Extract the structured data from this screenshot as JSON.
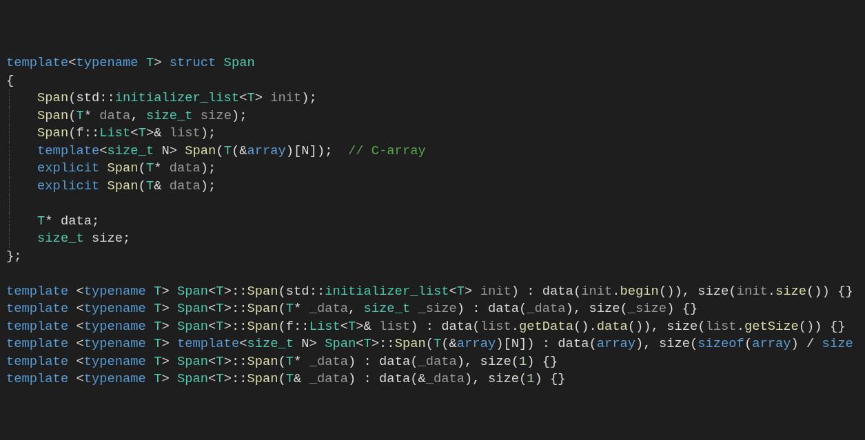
{
  "editor": {
    "blocks": [
      {
        "lines": [
          {
            "tokens": [
              {
                "kind": "keyword",
                "text": "template"
              },
              {
                "kind": "plain",
                "text": "<"
              },
              {
                "kind": "keyword",
                "text": "typename"
              },
              {
                "kind": "type",
                "text": " T"
              },
              {
                "kind": "plain",
                "text": "> "
              },
              {
                "kind": "keyword",
                "text": "struct"
              },
              {
                "kind": "type",
                "text": " Span"
              }
            ]
          },
          {
            "tokens": [
              {
                "kind": "plain",
                "text": "{"
              }
            ]
          },
          {
            "guide": true,
            "tokens": [
              {
                "kind": "function",
                "text": "    Span"
              },
              {
                "kind": "plain",
                "text": "(std::"
              },
              {
                "kind": "type",
                "text": "initializer_list"
              },
              {
                "kind": "plain",
                "text": "<"
              },
              {
                "kind": "type",
                "text": "T"
              },
              {
                "kind": "plain",
                "text": "> "
              },
              {
                "kind": "param",
                "text": "init"
              },
              {
                "kind": "plain",
                "text": ");"
              }
            ]
          },
          {
            "guide": true,
            "tokens": [
              {
                "kind": "function",
                "text": "    Span"
              },
              {
                "kind": "plain",
                "text": "("
              },
              {
                "kind": "type",
                "text": "T"
              },
              {
                "kind": "plain",
                "text": "* "
              },
              {
                "kind": "param",
                "text": "data"
              },
              {
                "kind": "plain",
                "text": ", "
              },
              {
                "kind": "type",
                "text": "size_t"
              },
              {
                "kind": "param",
                "text": " size"
              },
              {
                "kind": "plain",
                "text": ");"
              }
            ]
          },
          {
            "guide": true,
            "tokens": [
              {
                "kind": "function",
                "text": "    Span"
              },
              {
                "kind": "plain",
                "text": "(f::"
              },
              {
                "kind": "type",
                "text": "List"
              },
              {
                "kind": "plain",
                "text": "<"
              },
              {
                "kind": "type",
                "text": "T"
              },
              {
                "kind": "plain",
                "text": ">& "
              },
              {
                "kind": "param",
                "text": "list"
              },
              {
                "kind": "plain",
                "text": ");"
              }
            ]
          },
          {
            "guide": true,
            "tokens": [
              {
                "kind": "keyword",
                "text": "    template"
              },
              {
                "kind": "plain",
                "text": "<"
              },
              {
                "kind": "type",
                "text": "size_t"
              },
              {
                "kind": "plain",
                "text": " N> "
              },
              {
                "kind": "function",
                "text": "Span"
              },
              {
                "kind": "plain",
                "text": "("
              },
              {
                "kind": "type",
                "text": "T"
              },
              {
                "kind": "plain",
                "text": "(&"
              },
              {
                "kind": "local",
                "text": "array"
              },
              {
                "kind": "plain",
                "text": ")[N]);  "
              },
              {
                "kind": "comment",
                "text": "// C-array"
              }
            ]
          },
          {
            "guide": true,
            "tokens": [
              {
                "kind": "keyword",
                "text": "    explicit"
              },
              {
                "kind": "function",
                "text": " Span"
              },
              {
                "kind": "plain",
                "text": "("
              },
              {
                "kind": "type",
                "text": "T"
              },
              {
                "kind": "plain",
                "text": "* "
              },
              {
                "kind": "param",
                "text": "data"
              },
              {
                "kind": "plain",
                "text": ");"
              }
            ]
          },
          {
            "guide": true,
            "tokens": [
              {
                "kind": "keyword",
                "text": "    explicit"
              },
              {
                "kind": "function",
                "text": " Span"
              },
              {
                "kind": "plain",
                "text": "("
              },
              {
                "kind": "type",
                "text": "T"
              },
              {
                "kind": "plain",
                "text": "& "
              },
              {
                "kind": "param",
                "text": "data"
              },
              {
                "kind": "plain",
                "text": ");"
              }
            ]
          },
          {
            "guide": true
          },
          {
            "guide": true,
            "tokens": [
              {
                "kind": "type",
                "text": "    T"
              },
              {
                "kind": "plain",
                "text": "* data;"
              }
            ]
          },
          {
            "guide": true,
            "tokens": [
              {
                "kind": "type",
                "text": "    size_t"
              },
              {
                "kind": "plain",
                "text": " size;"
              }
            ]
          },
          {
            "tokens": [
              {
                "kind": "plain",
                "text": "};"
              }
            ]
          }
        ]
      },
      {
        "lines": [
          {
            "tokens": [
              {
                "kind": "keyword",
                "text": "template"
              },
              {
                "kind": "plain",
                "text": " <"
              },
              {
                "kind": "keyword",
                "text": "typename"
              },
              {
                "kind": "type",
                "text": " T"
              },
              {
                "kind": "plain",
                "text": "> "
              },
              {
                "kind": "type",
                "text": "Span"
              },
              {
                "kind": "plain",
                "text": "<"
              },
              {
                "kind": "type",
                "text": "T"
              },
              {
                "kind": "plain",
                "text": ">::"
              },
              {
                "kind": "function",
                "text": "Span"
              },
              {
                "kind": "plain",
                "text": "(std::"
              },
              {
                "kind": "type",
                "text": "initializer_list"
              },
              {
                "kind": "plain",
                "text": "<"
              },
              {
                "kind": "type",
                "text": "T"
              },
              {
                "kind": "plain",
                "text": "> "
              },
              {
                "kind": "param",
                "text": "init"
              },
              {
                "kind": "plain",
                "text": ") : data("
              },
              {
                "kind": "param",
                "text": "init"
              },
              {
                "kind": "plain",
                "text": "."
              },
              {
                "kind": "function",
                "text": "begin"
              },
              {
                "kind": "plain",
                "text": "()), size("
              },
              {
                "kind": "param",
                "text": "init"
              },
              {
                "kind": "plain",
                "text": "."
              },
              {
                "kind": "function",
                "text": "size"
              },
              {
                "kind": "plain",
                "text": "()) {}"
              }
            ]
          },
          {
            "tokens": [
              {
                "kind": "keyword",
                "text": "template"
              },
              {
                "kind": "plain",
                "text": " <"
              },
              {
                "kind": "keyword",
                "text": "typename"
              },
              {
                "kind": "type",
                "text": " T"
              },
              {
                "kind": "plain",
                "text": "> "
              },
              {
                "kind": "type",
                "text": "Span"
              },
              {
                "kind": "plain",
                "text": "<"
              },
              {
                "kind": "type",
                "text": "T"
              },
              {
                "kind": "plain",
                "text": ">::"
              },
              {
                "kind": "function",
                "text": "Span"
              },
              {
                "kind": "plain",
                "text": "("
              },
              {
                "kind": "type",
                "text": "T"
              },
              {
                "kind": "plain",
                "text": "* "
              },
              {
                "kind": "param",
                "text": "_data"
              },
              {
                "kind": "plain",
                "text": ", "
              },
              {
                "kind": "type",
                "text": "size_t"
              },
              {
                "kind": "param",
                "text": " _size"
              },
              {
                "kind": "plain",
                "text": ") : data("
              },
              {
                "kind": "param",
                "text": "_data"
              },
              {
                "kind": "plain",
                "text": "), size("
              },
              {
                "kind": "param",
                "text": "_size"
              },
              {
                "kind": "plain",
                "text": ") {}"
              }
            ]
          },
          {
            "tokens": [
              {
                "kind": "keyword",
                "text": "template"
              },
              {
                "kind": "plain",
                "text": " <"
              },
              {
                "kind": "keyword",
                "text": "typename"
              },
              {
                "kind": "type",
                "text": " T"
              },
              {
                "kind": "plain",
                "text": "> "
              },
              {
                "kind": "type",
                "text": "Span"
              },
              {
                "kind": "plain",
                "text": "<"
              },
              {
                "kind": "type",
                "text": "T"
              },
              {
                "kind": "plain",
                "text": ">::"
              },
              {
                "kind": "function",
                "text": "Span"
              },
              {
                "kind": "plain",
                "text": "(f::"
              },
              {
                "kind": "type",
                "text": "List"
              },
              {
                "kind": "plain",
                "text": "<"
              },
              {
                "kind": "type",
                "text": "T"
              },
              {
                "kind": "plain",
                "text": ">& "
              },
              {
                "kind": "param",
                "text": "list"
              },
              {
                "kind": "plain",
                "text": ") : data("
              },
              {
                "kind": "param",
                "text": "list"
              },
              {
                "kind": "plain",
                "text": "."
              },
              {
                "kind": "function",
                "text": "getData"
              },
              {
                "kind": "plain",
                "text": "()."
              },
              {
                "kind": "function",
                "text": "data"
              },
              {
                "kind": "plain",
                "text": "()), size("
              },
              {
                "kind": "param",
                "text": "list"
              },
              {
                "kind": "plain",
                "text": "."
              },
              {
                "kind": "function",
                "text": "getSize"
              },
              {
                "kind": "plain",
                "text": "()) {}"
              }
            ]
          },
          {
            "tokens": [
              {
                "kind": "keyword",
                "text": "template"
              },
              {
                "kind": "plain",
                "text": " <"
              },
              {
                "kind": "keyword",
                "text": "typename"
              },
              {
                "kind": "type",
                "text": " T"
              },
              {
                "kind": "plain",
                "text": "> "
              },
              {
                "kind": "keyword",
                "text": "template"
              },
              {
                "kind": "plain",
                "text": "<"
              },
              {
                "kind": "type",
                "text": "size_t"
              },
              {
                "kind": "plain",
                "text": " N> "
              },
              {
                "kind": "type",
                "text": "Span"
              },
              {
                "kind": "plain",
                "text": "<"
              },
              {
                "kind": "type",
                "text": "T"
              },
              {
                "kind": "plain",
                "text": ">::"
              },
              {
                "kind": "function",
                "text": "Span"
              },
              {
                "kind": "plain",
                "text": "("
              },
              {
                "kind": "type",
                "text": "T"
              },
              {
                "kind": "plain",
                "text": "(&"
              },
              {
                "kind": "local",
                "text": "array"
              },
              {
                "kind": "plain",
                "text": ")[N]) : data("
              },
              {
                "kind": "local",
                "text": "array"
              },
              {
                "kind": "plain",
                "text": "), size("
              },
              {
                "kind": "keyword",
                "text": "sizeof"
              },
              {
                "kind": "plain",
                "text": "("
              },
              {
                "kind": "local",
                "text": "array"
              },
              {
                "kind": "plain",
                "text": ") / "
              },
              {
                "kind": "keyword",
                "text": "size"
              }
            ]
          },
          {
            "tokens": [
              {
                "kind": "keyword",
                "text": "template"
              },
              {
                "kind": "plain",
                "text": " <"
              },
              {
                "kind": "keyword",
                "text": "typename"
              },
              {
                "kind": "type",
                "text": " T"
              },
              {
                "kind": "plain",
                "text": "> "
              },
              {
                "kind": "type",
                "text": "Span"
              },
              {
                "kind": "plain",
                "text": "<"
              },
              {
                "kind": "type",
                "text": "T"
              },
              {
                "kind": "plain",
                "text": ">::"
              },
              {
                "kind": "function",
                "text": "Span"
              },
              {
                "kind": "plain",
                "text": "("
              },
              {
                "kind": "type",
                "text": "T"
              },
              {
                "kind": "plain",
                "text": "* "
              },
              {
                "kind": "param",
                "text": "_data"
              },
              {
                "kind": "plain",
                "text": ") : data("
              },
              {
                "kind": "param",
                "text": "_data"
              },
              {
                "kind": "plain",
                "text": "), size("
              },
              {
                "kind": "number",
                "text": "1"
              },
              {
                "kind": "plain",
                "text": ") {}"
              }
            ]
          },
          {
            "tokens": [
              {
                "kind": "keyword",
                "text": "template"
              },
              {
                "kind": "plain",
                "text": " <"
              },
              {
                "kind": "keyword",
                "text": "typename"
              },
              {
                "kind": "type",
                "text": " T"
              },
              {
                "kind": "plain",
                "text": "> "
              },
              {
                "kind": "type",
                "text": "Span"
              },
              {
                "kind": "plain",
                "text": "<"
              },
              {
                "kind": "type",
                "text": "T"
              },
              {
                "kind": "plain",
                "text": ">::"
              },
              {
                "kind": "function",
                "text": "Span"
              },
              {
                "kind": "plain",
                "text": "("
              },
              {
                "kind": "type",
                "text": "T"
              },
              {
                "kind": "plain",
                "text": "& "
              },
              {
                "kind": "param",
                "text": "_data"
              },
              {
                "kind": "plain",
                "text": ") : data(&"
              },
              {
                "kind": "param",
                "text": "_data"
              },
              {
                "kind": "plain",
                "text": "), size("
              },
              {
                "kind": "number",
                "text": "1"
              },
              {
                "kind": "plain",
                "text": ") {}"
              }
            ]
          }
        ]
      }
    ]
  }
}
